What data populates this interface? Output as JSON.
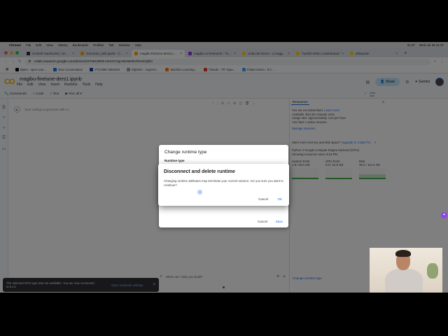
{
  "mac_menubar": {
    "apple_icon": "apple-icon",
    "items": [
      "Chrome",
      "File",
      "Edit",
      "View",
      "History",
      "Bookmarks",
      "Profiles",
      "Tab",
      "Window",
      "Help"
    ],
    "time": "21:37",
    "date": "Wed Jul 30  21:37"
  },
  "browser": {
    "tabs": [
      {
        "label": "Unsloth Notebooks | Unsloth",
        "active": false,
        "color": "#2f2f2f"
      },
      {
        "label": "Gemma3_(4B).ipynb - Colab",
        "active": false,
        "color": "#f9ab00"
      },
      {
        "label": "magibu-finetune-dersi1.ipynb",
        "active": true,
        "color": "#f9ab00"
      },
      {
        "label": "magibu AI Research - Turkish",
        "active": false,
        "color": "#9334e6"
      },
      {
        "label": "Uula Lite Demo - a Hugging Face",
        "active": false,
        "color": "#ffd21e"
      },
      {
        "label": "Turkish Mmlu Leaderboard",
        "active": false,
        "color": "#ffd21e"
      },
      {
        "label": "alibayram",
        "active": false,
        "color": "#ffd21e"
      }
    ],
    "url": "colab.research.google.com/drive/1hSTWX3RM-HeX2Yr3g-MCMNNVRe4KQBG",
    "bookmarks": [
      "Bytes - open sour...",
      "New Conversation",
      "YTÜ BİM Haberleri",
      "Eğitmler - Superm...",
      "Machine Learning...",
      "Timeds - TR Yapa...",
      "Flutter Demo - 8 C..."
    ]
  },
  "colab": {
    "logo_text": "CO",
    "notebook_title": "magibu-finetune-ders1.ipynb",
    "menu": [
      "File",
      "Edit",
      "View",
      "Insert",
      "Runtime",
      "Tools",
      "Help"
    ],
    "share_label": "Share",
    "gemini_label": "Gemini",
    "ram_label": "RAM",
    "disk_label": "Disk",
    "toolbar": {
      "commands": "Commands",
      "code": "+ Code",
      "text": "+ Text",
      "run_all": "Run all"
    },
    "cell_placeholder": "Start coding or generate with AI.",
    "prompt_placeholder": "What can I help you build?"
  },
  "resources": {
    "tab_label": "Resources",
    "lines": [
      "You are not subscribed.",
      "Available: $23.38 compute units",
      "Usage rate: approximately 2.04 per hour",
      "You have 1 active session."
    ],
    "learn_more": "Learn more",
    "manage_sessions": "Manage sessions",
    "upsell_text": "Want more memory and disk space?",
    "upgrade_link": "Upgrade to Colab Pro",
    "backend_text": "Python 3 Google Compute Engine backend (GPU)",
    "since_text": "Showing resources since 9:16 PM",
    "gauges": [
      {
        "label": "System RAM",
        "value": "1.8 / 53.0 GB",
        "fraction": 0.03
      },
      {
        "label": "GPU RAM",
        "value": "0.0 / 22.5 GB",
        "fraction": 0.0
      },
      {
        "label": "Disk",
        "value": "38.2 / 112.6 GB",
        "fraction": 0.34
      }
    ],
    "change_runtime": "Change runtime type"
  },
  "status_right": "Python 3",
  "snackbar": {
    "message": "The selected GPU type was not available. You are now connected to a L4.",
    "action": "Open notebook settings"
  },
  "dialog_back": {
    "title": "Change runtime type",
    "subtitle": "Runtime type",
    "cancel": "Cancel",
    "save": "Save"
  },
  "dialog_front": {
    "title": "Disconnect and delete runtime",
    "message": "Changing runtime attributes may terminate your current session. Are you sure you want to continue?",
    "cancel": "Cancel",
    "ok": "OK"
  }
}
